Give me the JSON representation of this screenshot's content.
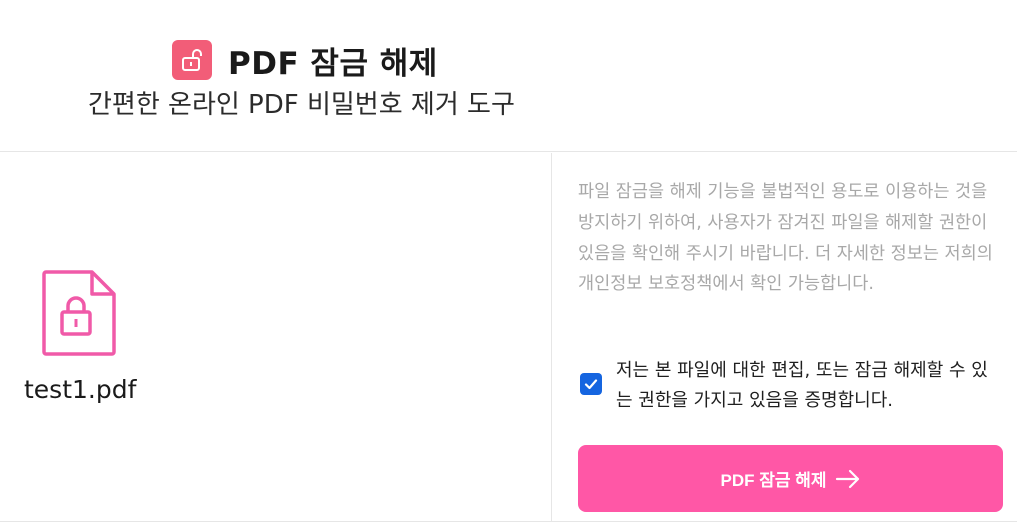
{
  "header": {
    "title": "PDF 잠금 해제",
    "subtitle": "간편한 온라인 PDF 비밀번호 제거 도구",
    "icon": "unlock-icon"
  },
  "file": {
    "name": "test1.pdf",
    "icon": "locked-file-icon"
  },
  "notice": "파일 잠금을 해제 기능을 불법적인 용도로 이용하는 것을 방지하기 위하여, 사용자가 잠겨진 파일을 해제할 권한이 있음을 확인해 주시기 바랍니다. 더 자세한 정보는 저희의 개인정보 보호정책에서 확인 가능합니다.",
  "consent": {
    "checked": true,
    "text": "저는 본 파일에 대한 편집, 또는 잠금 해제할 수 있는 권한을 가지고 있음을 증명합니다."
  },
  "action": {
    "label": "PDF 잠금 해제",
    "icon": "arrow-right-icon"
  },
  "colors": {
    "accent": "#ff57a6",
    "icon_bg": "#f25d78",
    "file_icon": "#f05aa8",
    "checkbox": "#1565e0"
  }
}
